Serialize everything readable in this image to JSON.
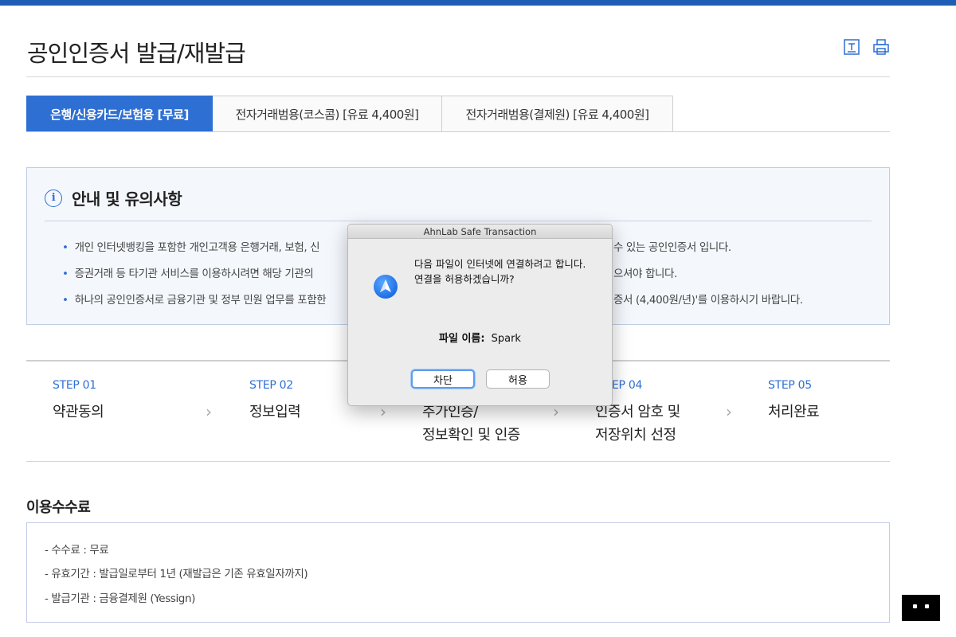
{
  "page": {
    "title": "공인인증서 발급/재발급",
    "toolbar": {
      "text_icon": "text-size-icon",
      "print_icon": "print-icon"
    }
  },
  "tabs": [
    {
      "label": "은행/신용카드/보험용 [무료]",
      "active": true
    },
    {
      "label": "전자거래범용(코스콤) [유료 4,400원]",
      "active": false
    },
    {
      "label": "전자거래범용(결제원) [유료 4,400원]",
      "active": false
    }
  ],
  "notice": {
    "title": "안내 및 유의사항",
    "lines": [
      {
        "bullet": "•",
        "left": "개인 인터넷뱅킹을 포함한 개인고객용 은행거래, 보험, 신",
        "right": "수 있는 공인인증서 입니다."
      },
      {
        "bullet": "•",
        "left": "증권거래 등 타기관 서비스를 이용하시려면 해당 기관의 ",
        "right": "으셔야 합니다."
      },
      {
        "bullet": "•",
        "left": "하나의 공인인증서로 금융기관 및 정부 민원 업무를 포함한",
        "right": "증서 (4,400원/년)'를 이용하시기 바랍니다."
      }
    ]
  },
  "steps": [
    {
      "num": "STEP 01",
      "label": "약관동의",
      "label2": ""
    },
    {
      "num": "STEP 02",
      "label": "정보입력",
      "label2": ""
    },
    {
      "num": "",
      "label": "추가인증/",
      "label2": "정보확인 및 인증"
    },
    {
      "num": "EP 04",
      "label": "인증서 암호 및",
      "label2": "저장위치 선정"
    },
    {
      "num": "STEP 05",
      "label": "처리완료",
      "label2": ""
    }
  ],
  "fees": {
    "title": "이용수수료",
    "lines": [
      "- 수수료 : 무료",
      "- 유효기간 : 발급일로부터 1년 (재발급은 기존 유효일자까지)",
      "- 발급기관 : 금융결제원 (Yessign)"
    ]
  },
  "dialog": {
    "title": "AhnLab Safe Transaction",
    "message": "다음 파일이 인터넷에 연결하려고 합니다. 연결을 허용하겠습니까?",
    "file_label": "파일 이름:",
    "file_name": "Spark",
    "block_button": "차단",
    "allow_button": "허용",
    "icon": "spark-app-icon"
  },
  "colors": {
    "accent": "#2e6fd3",
    "top_bar": "#1f5eb5",
    "notice_bg": "#f4f8fd"
  }
}
